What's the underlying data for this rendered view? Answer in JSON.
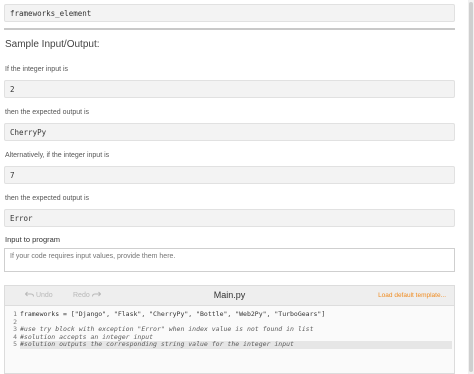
{
  "top_code": "frameworks_element",
  "section_title": "Sample Input/Output:",
  "examples": [
    {
      "intro": "If the integer input is",
      "input": "2",
      "then": "then the expected output is",
      "output": "CherryPy"
    },
    {
      "intro": "Alternatively, if the integer input is",
      "input": "7",
      "then": "then the expected output is",
      "output": "Error"
    }
  ],
  "program_input": {
    "label": "Input to program",
    "placeholder": "If your code requires input values, provide them here."
  },
  "editor": {
    "undo_label": "Undo",
    "redo_label": "Redo",
    "file_name": "Main.py",
    "load_template_label": "Load default template...",
    "line_numbers": [
      "1",
      "2",
      "3",
      "4",
      "5"
    ],
    "lines": [
      "frameworks = [\"Django\", \"Flask\", \"CherryPy\", \"Bottle\", \"Web2Py\", \"TurboGears\"]",
      "",
      "#use try block with exception \"Error\" when index value is not found in list",
      "#solution accepts an integer input",
      "#solution outputs the corresponding string value for the integer input"
    ]
  },
  "colors": {
    "accent_orange": "#f08a1d",
    "code_bg": "#f3f3f3"
  }
}
